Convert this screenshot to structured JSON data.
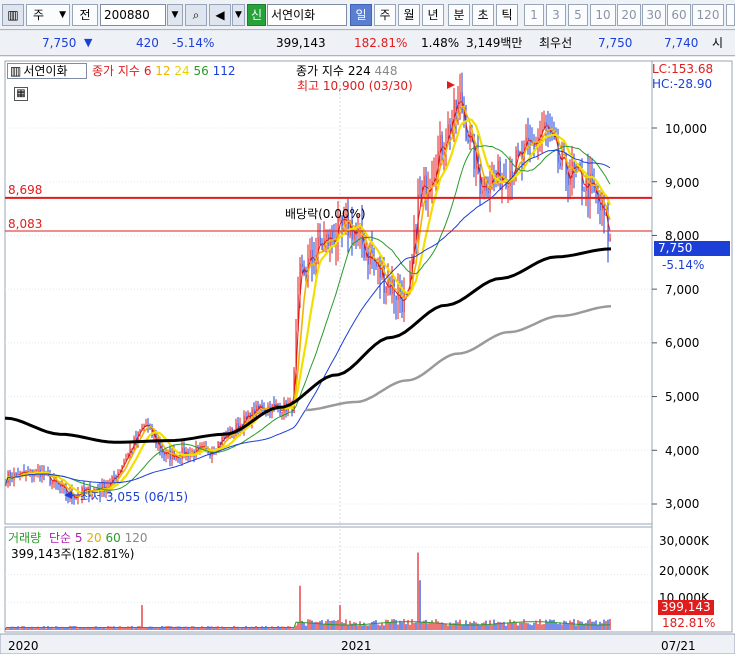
{
  "toolbar": {
    "market_type": "주",
    "period_type": "전",
    "code": "200880",
    "name_badge": "신",
    "stock_name": "서연이화",
    "periods": [
      "일",
      "주",
      "월",
      "년",
      "분",
      "초",
      "틱"
    ],
    "selected_period": "일",
    "intervals": [
      "1",
      "3",
      "5",
      "10",
      "20",
      "30",
      "60",
      "120"
    ]
  },
  "quote": {
    "price": "7,750",
    "direction_icon": "down-triangle-icon",
    "change": "420",
    "change_pct": "-5.14%",
    "volume": "399,143",
    "volume_ratio": "182.81%",
    "turnover": "1.48%",
    "amount": "3,149백만",
    "ask_label": "최우선",
    "ask": "7,750",
    "bid": "7,740",
    "extra": "시"
  },
  "chart": {
    "stock_label": "서연이화",
    "ma_legend_title": "종가 지수",
    "ma_periods": [
      "6",
      "12",
      "24",
      "56",
      "112"
    ],
    "ma_colors": [
      "#e01c1c",
      "#f2c200",
      "#f0e000",
      "#2a9a2a",
      "#1c3fd8"
    ],
    "long_legend_title": "종가 지수",
    "long_periods": [
      "224",
      "448"
    ],
    "lc": "LC:153.68",
    "hc": "HC:-28.90",
    "high_label": "최고 10,900 (03/30)",
    "low_label": "최저 3,055 (06/15)",
    "dividend_label": "배당락(0.00%)",
    "hline1": "8,698",
    "hline2": "8,083",
    "current_price": "7,750",
    "current_pct": "-5.14%",
    "y_ticks": [
      "10,000",
      "9,000",
      "8,000",
      "7,000",
      "6,000",
      "5,000",
      "4,000",
      "3,000"
    ],
    "x_labels": [
      "2020",
      "2021",
      "07/21"
    ]
  },
  "volume_panel": {
    "legend_title": "거래량",
    "ma_title": "단순",
    "ma_periods": [
      "5",
      "20",
      "60",
      "120"
    ],
    "current": "399,143주(182.81%)",
    "y_ticks": [
      "30,000K",
      "20,000K",
      "10,000K"
    ],
    "badge_value": "399,143",
    "badge_pct": "182.81%"
  },
  "chart_data": {
    "type": "line",
    "y_range": [
      2500,
      10900
    ],
    "series": [
      {
        "name": "종가 지수 224",
        "approx_values": [
          4600,
          4300,
          4150,
          4180,
          4300,
          4800,
          5400,
          6100,
          6700,
          7200,
          7600,
          7750
        ]
      },
      {
        "name": "종가 지수 448",
        "approx_values": [
          4750,
          4900,
          5300,
          5800,
          6200,
          6500,
          6680
        ]
      }
    ]
  }
}
